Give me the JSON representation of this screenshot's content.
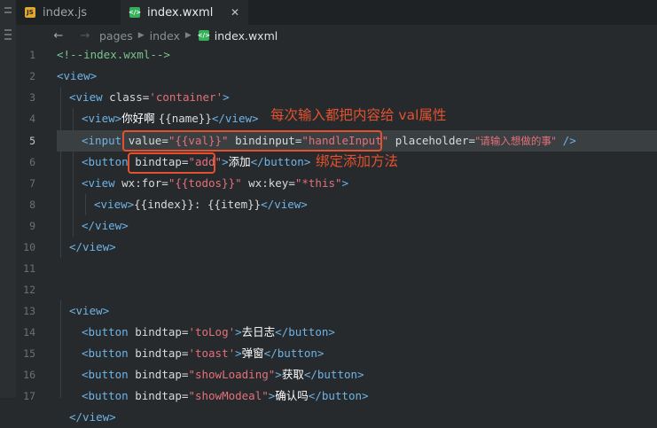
{
  "tabs": [
    {
      "label": "index.js",
      "icon": "js-file-icon",
      "icon_text": "JS",
      "active": false
    },
    {
      "label": "index.wxml",
      "icon": "wxml-file-icon",
      "icon_text": "</>",
      "active": true
    }
  ],
  "close_glyph": "✕",
  "breadcrumb": [
    "pages",
    "index",
    "index.wxml"
  ],
  "line_numbers": [
    "1",
    "2",
    "3",
    "4",
    "5",
    "6",
    "7",
    "8",
    "9",
    "10",
    "11",
    "12",
    "13",
    "14",
    "15",
    "16",
    "17"
  ],
  "current_line": "5",
  "code": {
    "l1": "<!--index.wxml-->",
    "l2_tag": "<view>",
    "l3_open": "<view ",
    "l3_attr": "class=",
    "l3_val": "'container'",
    "l3_close": ">",
    "l4_open": "<view>",
    "l4_text": "你好啊 ",
    "l4_expr": "{{name}}",
    "l4_close": "</view>",
    "l5_open": "<input ",
    "l5_a1": "value=",
    "l5_v1": "\"{{val}}\"",
    "l5_a2": " bindinput=",
    "l5_v2": "\"handleInput\"",
    "l5_a3": " placeholder=",
    "l5_v3": "\"请输入想做的事\"",
    "l5_close": " />",
    "l6_open": "<button ",
    "l6_attr": "bindtap=",
    "l6_val": "\"add\"",
    "l6_gt": ">",
    "l6_text": "添加",
    "l6_close": "</button>",
    "l7_open": "<view ",
    "l7_a1": "wx:for=",
    "l7_v1": "\"{{todos}}\"",
    "l7_a2": " wx:key=",
    "l7_v2": "\"*this\"",
    "l7_gt": ">",
    "l8_open": "<view>",
    "l8_expr": "{{index}}: {{item}}",
    "l8_close": "</view>",
    "l9": "</view>",
    "l10": "</view>",
    "l12": "<view>",
    "l13_open": "<button ",
    "l13_attr": "bindtap=",
    "l13_val": "'toLog'",
    "l13_gt": ">",
    "l13_text": "去日志",
    "l13_close": "</button>",
    "l14_open": "<button ",
    "l14_attr": "bindtap=",
    "l14_val": "'toast'",
    "l14_gt": ">",
    "l14_text": "弹窗",
    "l14_close": "</button>",
    "l15_open": "<button ",
    "l15_attr": "bindtap=",
    "l15_val": "\"showLoading\"",
    "l15_gt": ">",
    "l15_text": "获取",
    "l15_close": "</button>",
    "l16_open": "<button ",
    "l16_attr": "bindtap=",
    "l16_val": "\"showModeal\"",
    "l16_gt": ">",
    "l16_text": "确认吗",
    "l16_close": "</button>",
    "l17": "</view>"
  },
  "annotations": {
    "input_note": "每次输入都把内容给 val属性",
    "button_note": "绑定添加方法"
  },
  "colors": {
    "annotation": "#e5512e",
    "tag": "#6fb3e6",
    "string": "#e4707a",
    "comment": "#79c28f"
  }
}
